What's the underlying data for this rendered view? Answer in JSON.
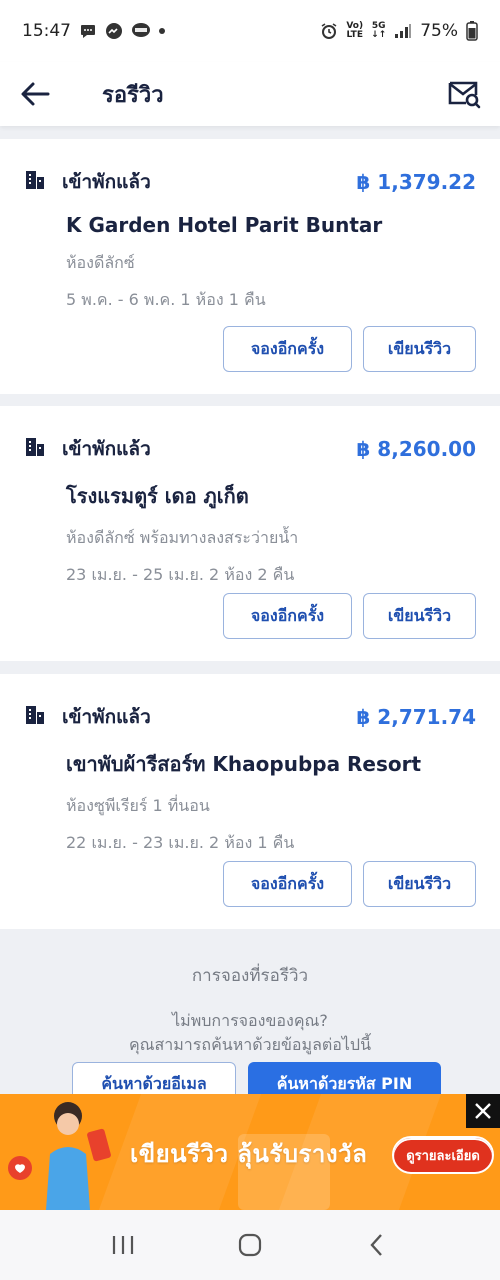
{
  "status_bar": {
    "time": "15:47",
    "volte": "Vo)\nLTE",
    "network": "5G",
    "battery": "75%"
  },
  "header": {
    "title": "รอรีวิว"
  },
  "bookings": [
    {
      "status": "เข้าพักแล้ว",
      "price": "฿ 1,379.22",
      "hotel": "K Garden Hotel Parit Buntar",
      "room": "ห้องดีลักซ์",
      "dates": "5 พ.ค. - 6 พ.ค. 1 ห้อง 1 คืน",
      "rebook_label": "จองอีกครั้ง",
      "review_label": "เขียนรีวิว"
    },
    {
      "status": "เข้าพักแล้ว",
      "price": "฿ 8,260.00",
      "hotel": "โรงแรมตูร์ เดอ ภูเก็ต",
      "room": "ห้องดีลักซ์ พร้อมทางลงสระว่ายน้ำ",
      "dates": "23 เม.ย. - 25 เม.ย. 2 ห้อง 2 คืน",
      "rebook_label": "จองอีกครั้ง",
      "review_label": "เขียนรีวิว"
    },
    {
      "status": "เข้าพักแล้ว",
      "price": "฿ 2,771.74",
      "hotel": "เขาพับผ้ารีสอร์ท Khaopubpa Resort",
      "room": "ห้องซูพีเรียร์ 1 ที่นอน",
      "dates": "22 เม.ย. - 23 เม.ย. 2 ห้อง 1 คืน",
      "rebook_label": "จองอีกครั้ง",
      "review_label": "เขียนรีวิว"
    }
  ],
  "info": {
    "title": "การจองที่รอรีวิว",
    "line1": "ไม่พบการจองของคุณ?",
    "line2": "คุณสามารถค้นหาด้วยข้อมูลต่อไปนี้",
    "search_email": "ค้นหาด้วยอีเมล",
    "search_pin": "ค้นหาด้วยรหัส PIN"
  },
  "banner": {
    "headline": "เขียนรีวิว ลุ้นรับรางวัล",
    "detail_button": "ดูรายละเอียด",
    "background_color": "#ff9a18"
  },
  "colors": {
    "accent": "#2f6fdc",
    "button_text": "#1f4fb0"
  }
}
